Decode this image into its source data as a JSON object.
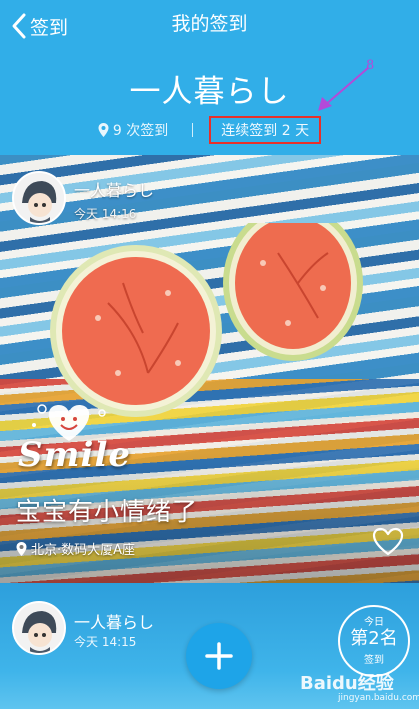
{
  "header": {
    "back_label": "签到",
    "title": "我的签到",
    "profile_name": "一人暮らし",
    "checkin_count": "9 次签到",
    "streak": "连续签到 2 天",
    "annotation": "8"
  },
  "post": {
    "user": "一人暮らし",
    "time": "今天 14:16",
    "sticker_text": "Smile",
    "caption": "宝宝有小情绪了",
    "location": "北京·数码大厦A座"
  },
  "next_post": {
    "user": "一人暮らし",
    "time": "今天 14:15"
  },
  "rank_badge": {
    "top": "今日",
    "main": "第2名",
    "bottom": "签到"
  },
  "watermark": {
    "brand": "Baidu经验",
    "url": "jingyan.baidu.com"
  },
  "colors": {
    "header_blue": "#31aee8",
    "accent_red": "#e8302a",
    "annotation_purple": "#b34ad9",
    "add_button": "#1ea4e8"
  },
  "icons": {
    "back": "chevron-left-icon",
    "location": "location-pin-icon",
    "like": "heart-outline-icon",
    "add": "plus-icon"
  }
}
